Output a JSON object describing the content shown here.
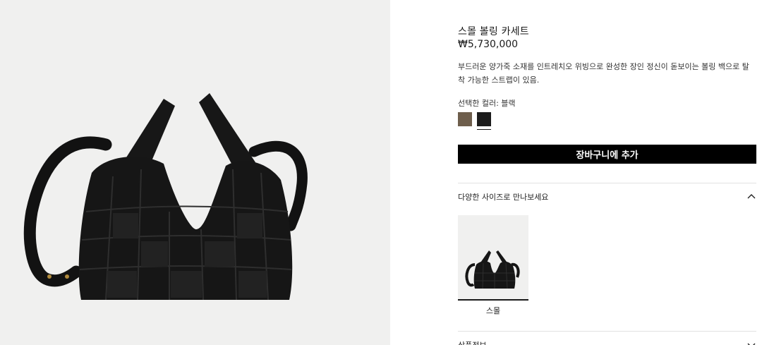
{
  "product": {
    "title": "스몰 볼링 카세트",
    "price": "₩5,730,000",
    "description": "부드러운 양가죽 소재를 인트레치오 위빙으로 완성한 장인 정신이 돋보이는 볼링 백으로 탈착 가능한 스트랩이 있음.",
    "color_label": "선택한 컬러: 블랙",
    "colors": [
      {
        "name": "brown",
        "hex": "#6e5e4c"
      },
      {
        "name": "black",
        "hex": "#1c1c1c",
        "selected": true
      }
    ]
  },
  "actions": {
    "add_to_cart": "장바구니에 추가"
  },
  "sizes_section": {
    "label": "다양한 사이즈로 만나보세요",
    "expanded": true,
    "options": [
      {
        "label": "스몰",
        "selected": true
      }
    ]
  },
  "info_section": {
    "label": "상품정보",
    "expanded": false
  },
  "icons": {
    "sizes_toggle": "chevron-up-icon",
    "info_toggle": "chevron-down-icon"
  }
}
